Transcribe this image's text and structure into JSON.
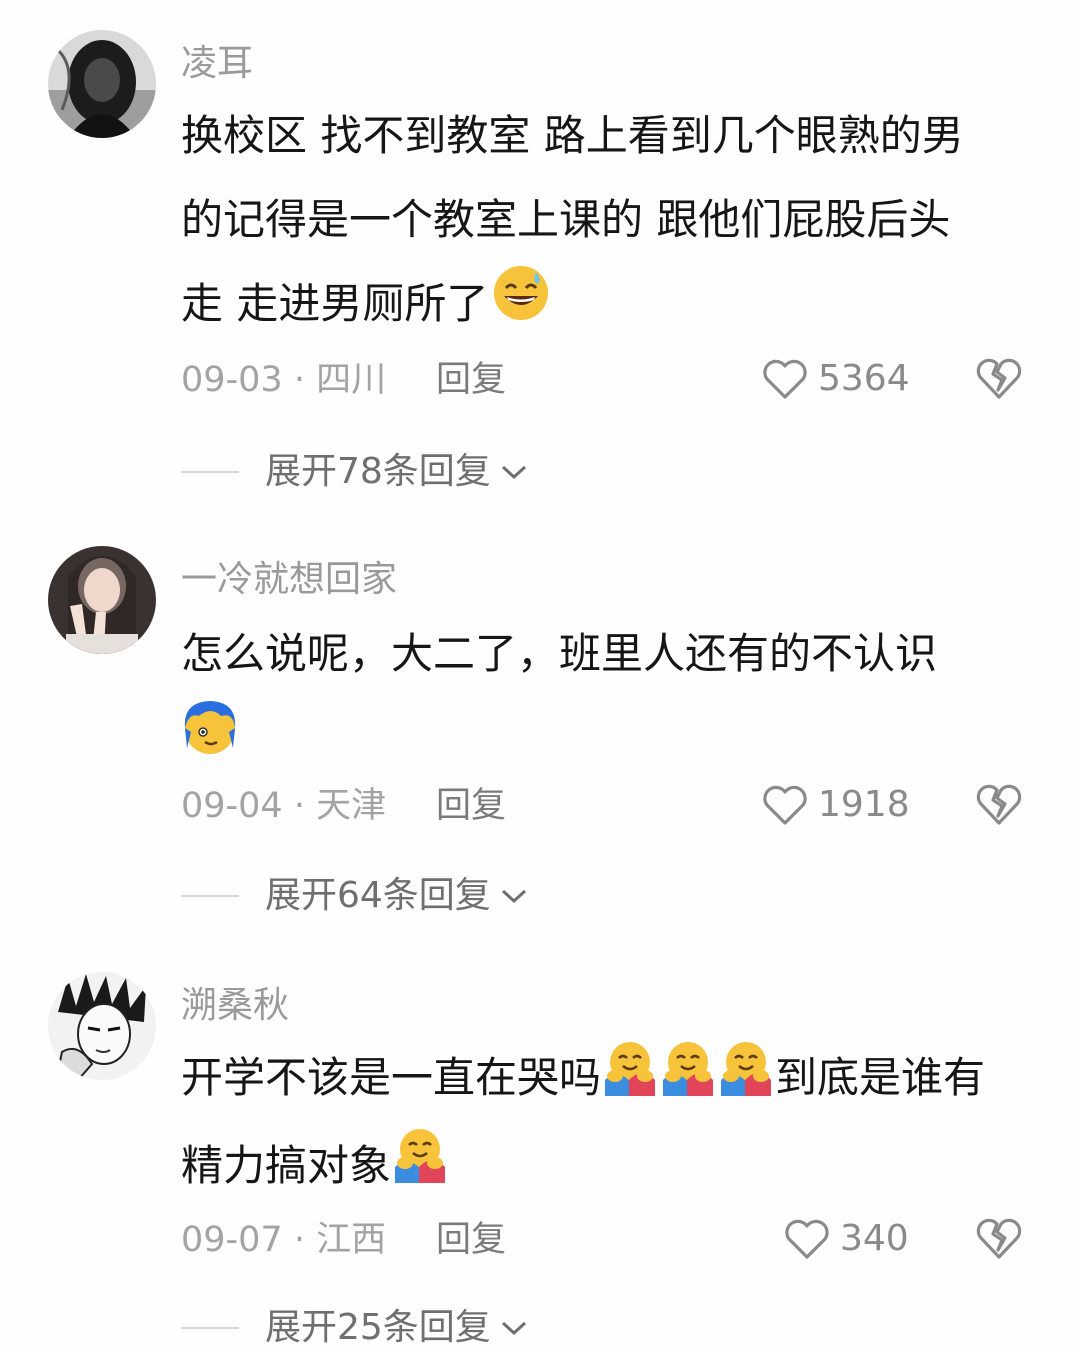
{
  "comments": [
    {
      "username": "凌耳",
      "line1": "换校区 找不到教室 路上看到几个眼熟的男",
      "line2": "的记得是一个教室上课的 跟他们屁股后头",
      "line3": "走 走进男厕所了",
      "emoji": "grinning-sweat-emoji",
      "date": "09-03",
      "location": "四川",
      "reply_label": "回复",
      "likes": "5364",
      "expand_label": "展开78条回复"
    },
    {
      "username": "一冷就想回家",
      "line1": "怎么说呢，大二了，班里人还有的不认识",
      "emoji": "blue-hair-face-emoji",
      "date": "09-04",
      "location": "天津",
      "reply_label": "回复",
      "likes": "1918",
      "expand_label": "展开64条回复"
    },
    {
      "username": "溯桑秋",
      "line1a": "开学不该是一直在哭吗",
      "line1b": "到底是谁有",
      "line2": "精力搞对象",
      "emoji": "hugging-face-emoji",
      "date": "09-07",
      "location": "江西",
      "reply_label": "回复",
      "likes": "340",
      "expand_label": "展开25条回复"
    }
  ],
  "meta_separator": "·",
  "colors": {
    "text": "#161616",
    "muted": "#a3a3a3",
    "icon": "#8a8a8a",
    "emoji_yellow": "#f7c33a",
    "hug_pink": "#e0455a",
    "hug_blue": "#3b8de0"
  }
}
